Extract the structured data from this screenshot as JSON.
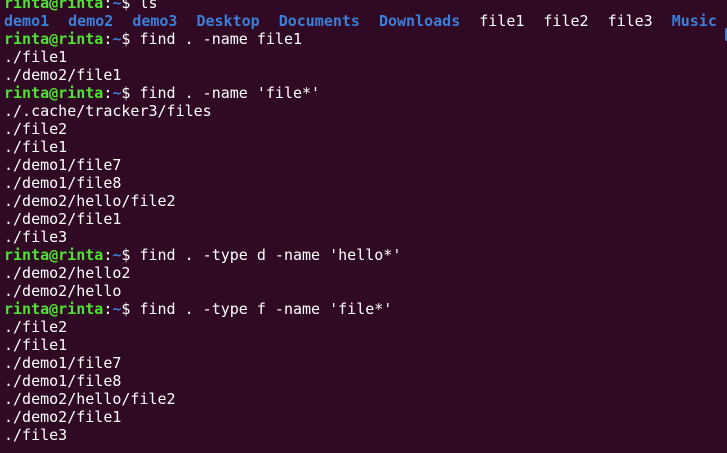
{
  "prompt": {
    "user_host": "rinta@rinta",
    "separator": ":",
    "path": "~",
    "symbol": "$"
  },
  "session": [
    {
      "command": "ls",
      "output": []
    },
    {
      "command": "find . -name file1",
      "output": [
        "./file1",
        "./demo2/file1"
      ]
    },
    {
      "command": "find . -name 'file*'",
      "output": [
        "./.cache/tracker3/files",
        "./file2",
        "./file1",
        "./demo1/file7",
        "./demo1/file8",
        "./demo2/hello/file2",
        "./demo2/file1",
        "./file3"
      ]
    },
    {
      "command": "find . -type d -name 'hello*'",
      "output": [
        "./demo2/hello2",
        "./demo2/hello"
      ]
    },
    {
      "command": "find . -type f -name 'file*'",
      "output": [
        "./file2",
        "./file1",
        "./demo1/file7",
        "./demo1/file8",
        "./demo2/hello/file2",
        "./demo2/file1",
        "./file3"
      ]
    }
  ],
  "ls_entries": [
    {
      "name": "demo1",
      "kind": "directory"
    },
    {
      "name": "demo2",
      "kind": "directory"
    },
    {
      "name": "demo3",
      "kind": "directory"
    },
    {
      "name": "Desktop",
      "kind": "directory"
    },
    {
      "name": "Documents",
      "kind": "directory"
    },
    {
      "name": "Downloads",
      "kind": "directory"
    },
    {
      "name": "file1",
      "kind": "file"
    },
    {
      "name": "file2",
      "kind": "file"
    },
    {
      "name": "file3",
      "kind": "file"
    },
    {
      "name": "Music",
      "kind": "directory"
    }
  ],
  "colors": {
    "background": "#300a24",
    "prompt_user": "#4fe334",
    "prompt_path": "#3c7fd9",
    "directory": "#3c7fd9",
    "text": "#ffffff"
  }
}
